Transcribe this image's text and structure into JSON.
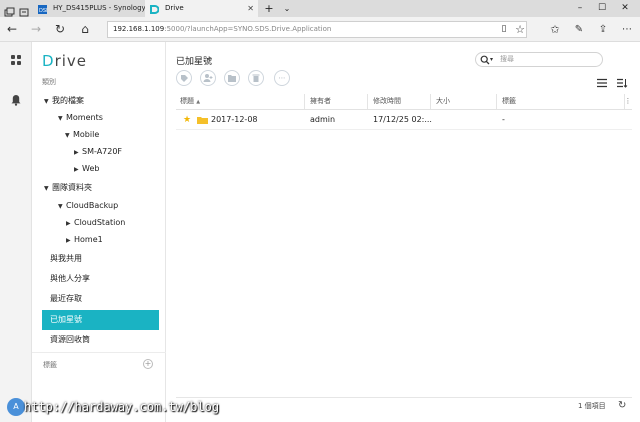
{
  "browser": {
    "tabs": [
      {
        "title": "HY_DS415PLUS - Synology I",
        "icon": "synology-icon",
        "active": false
      },
      {
        "title": "Drive",
        "icon": "drive-icon",
        "active": true
      }
    ],
    "address": {
      "host": "192.168.1.109",
      "rest": ":5000/?launchApp=SYNO.SDS.Drive.Application"
    }
  },
  "app": {
    "logo": "Drive",
    "sidebar": {
      "section_label": "類別",
      "tree": [
        {
          "label": "我的檔案",
          "level": 0,
          "caret": "down"
        },
        {
          "label": "Moments",
          "level": 1,
          "caret": "down"
        },
        {
          "label": "Mobile",
          "level": 2,
          "caret": "down"
        },
        {
          "label": "SM-A720F",
          "level": 3,
          "caret": "right"
        },
        {
          "label": "Web",
          "level": 3,
          "caret": "right"
        },
        {
          "label": "團隊資料夾",
          "level": 0,
          "caret": "down"
        },
        {
          "label": "CloudBackup",
          "level": 1,
          "caret": "down"
        },
        {
          "label": "CloudStation",
          "level": 2,
          "caret": "right"
        },
        {
          "label": "Home1",
          "level": 2,
          "caret": "right"
        }
      ],
      "links": [
        {
          "label": "與我共用",
          "selected": false
        },
        {
          "label": "與他人分享",
          "selected": false
        },
        {
          "label": "最近存取",
          "selected": false
        },
        {
          "label": "已加星號",
          "selected": true
        },
        {
          "label": "資源回收筒",
          "selected": false
        }
      ],
      "labels_label": "標籤",
      "avatar_initials": "A"
    },
    "main": {
      "title": "已加星號",
      "search_placeholder": "搜尋",
      "columns": [
        "標題",
        "擁有者",
        "修改時間",
        "大小",
        "標籤"
      ],
      "sort_indicator": "▲",
      "rows": [
        {
          "title": "2017-12-08",
          "owner": "admin",
          "modified": "17/12/25 02:...",
          "size": "",
          "tag": "-"
        }
      ],
      "footer_count": "1 個項目"
    },
    "accent_color": "#1ab3c3"
  },
  "watermark": "http://hardaway.com.tw/blog"
}
